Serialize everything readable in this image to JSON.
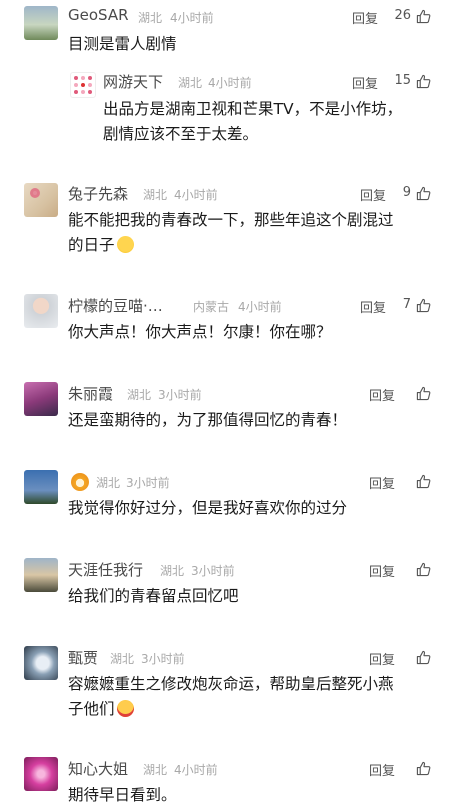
{
  "ui": {
    "reply_label": "回复"
  },
  "comments": [
    {
      "name": "GeoSAR",
      "location": "湖北",
      "time": "4小时前",
      "likes": "26",
      "text_lines": [
        "目测是雷人剧情"
      ]
    },
    {
      "name": "网游天下",
      "location": "湖北",
      "time": "4小时前",
      "likes": "15",
      "text_lines": [
        "出品方是湖南卫视和芒果TV，不是小作坊，",
        "剧情应该不至于太差。"
      ],
      "is_reply": true
    },
    {
      "name": "兔子先森",
      "location": "湖北",
      "time": "4小时前",
      "likes": "9",
      "text_lines": [
        "能不能把我的青春改一下，那些年追这个剧混过",
        "的日子"
      ],
      "emoji": "crying-face-emoji"
    },
    {
      "name": "柠檬的豆喵·…",
      "location": "内蒙古",
      "time": "4小时前",
      "likes": "7",
      "text_lines": [
        "你大声点！你大声点！尔康！你在哪？"
      ]
    },
    {
      "name": "朱丽霞",
      "location": "湖北",
      "time": "3小时前",
      "likes": "",
      "text_lines": [
        "还是蛮期待的，为了那值得回忆的青春！"
      ]
    },
    {
      "name": "",
      "name_emoji": "tiger-face-emoji",
      "location": "湖北",
      "time": "3小时前",
      "likes": "",
      "text_lines": [
        "我觉得你好过分，但是我好喜欢你的过分"
      ]
    },
    {
      "name": "天涯任我行",
      "location": "湖北",
      "time": "3小时前",
      "likes": "",
      "text_lines": [
        "给我们的青春留点回忆吧"
      ]
    },
    {
      "name": "甄贾",
      "location": "湖北",
      "time": "3小时前",
      "likes": "",
      "text_lines": [
        "容嬷嬷重生之修改炮灰命运，帮助皇后整死小燕",
        "子他们"
      ],
      "emoji": "heart-eyes-emoji"
    },
    {
      "name": "知心大姐",
      "location": "湖北",
      "time": "4小时前",
      "likes": "",
      "text_lines": [
        "期待早日看到。"
      ]
    }
  ],
  "colors": {
    "name": "#4a4a4a",
    "meta": "#a8a8a8",
    "text": "#1a1a1a",
    "background": "#ffffff"
  }
}
